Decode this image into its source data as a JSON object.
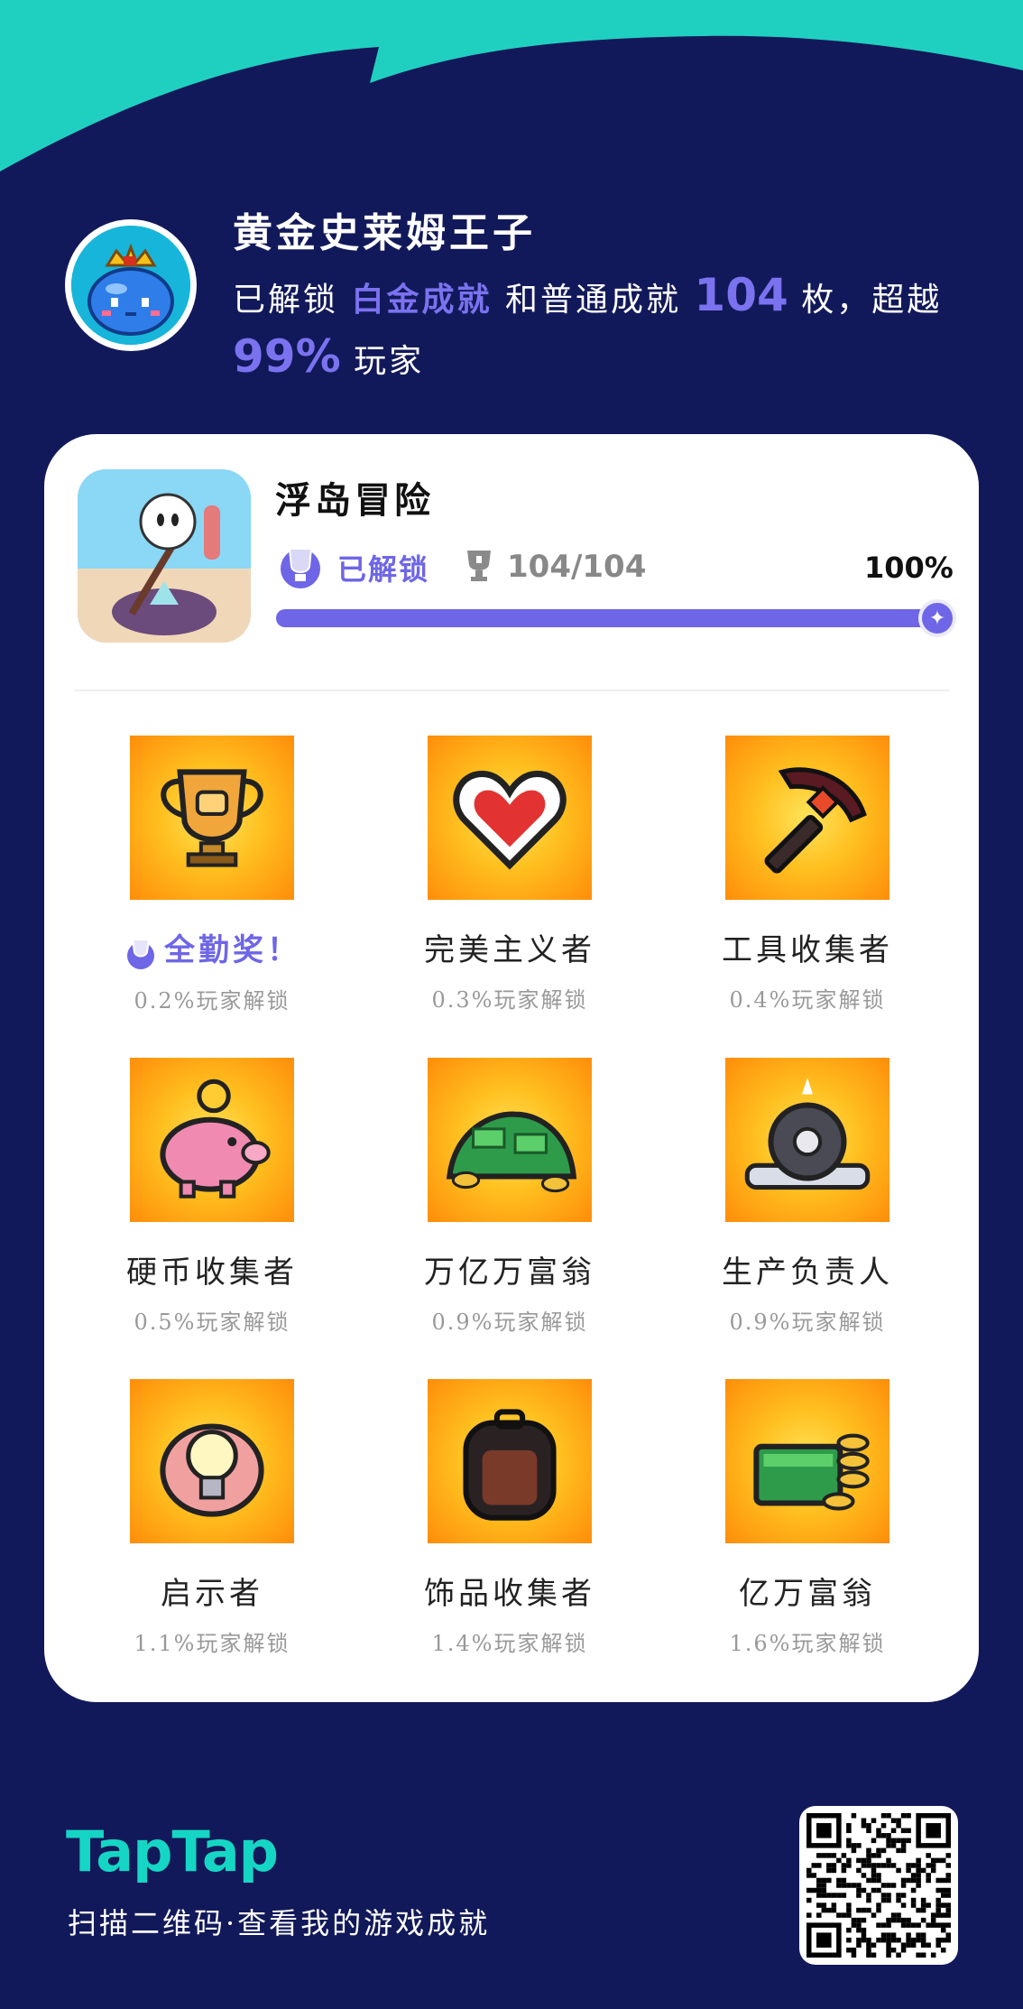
{
  "colors": {
    "background": "#12195a",
    "teal_accent": "#15d6c4",
    "purple_accent": "#6e66e6",
    "badge_gold": "#ffbf1f"
  },
  "header": {
    "title": "黄金史莱姆王子",
    "line_prefix": "已解锁",
    "platinum_text": "白金成就",
    "mid_text": "和普通成就",
    "count": "104",
    "suffix": "枚，超越",
    "percentile": "99%",
    "end_text": "玩家"
  },
  "game": {
    "name": "浮岛冒险",
    "unlocked_label": "已解锁",
    "trophy_count": "104/104",
    "progress_percent": "100%",
    "progress_fraction": 1.0
  },
  "achievements": [
    {
      "name": "全勤奖！",
      "pct": "0.2%玩家解锁",
      "platinum": true,
      "icon": "trophy-icon"
    },
    {
      "name": "完美主义者",
      "pct": "0.3%玩家解锁",
      "platinum": false,
      "icon": "heart-icon"
    },
    {
      "name": "工具收集者",
      "pct": "0.4%玩家解锁",
      "platinum": false,
      "icon": "pickaxe-icon"
    },
    {
      "name": "硬币收集者",
      "pct": "0.5%玩家解锁",
      "platinum": false,
      "icon": "piggy-bank-icon"
    },
    {
      "name": "万亿万富翁",
      "pct": "0.9%玩家解锁",
      "platinum": false,
      "icon": "money-pile-icon"
    },
    {
      "name": "生产负责人",
      "pct": "0.9%玩家解锁",
      "platinum": false,
      "icon": "gear-wrench-icon"
    },
    {
      "name": "启示者",
      "pct": "1.1%玩家解锁",
      "platinum": false,
      "icon": "lightbulb-icon"
    },
    {
      "name": "饰品收集者",
      "pct": "1.4%玩家解锁",
      "platinum": false,
      "icon": "backpack-icon"
    },
    {
      "name": "亿万富翁",
      "pct": "1.6%玩家解锁",
      "platinum": false,
      "icon": "cash-coins-icon"
    }
  ],
  "footer": {
    "brand": "TapTap",
    "scan_text": "扫描二维码·查看我的游戏成就"
  }
}
